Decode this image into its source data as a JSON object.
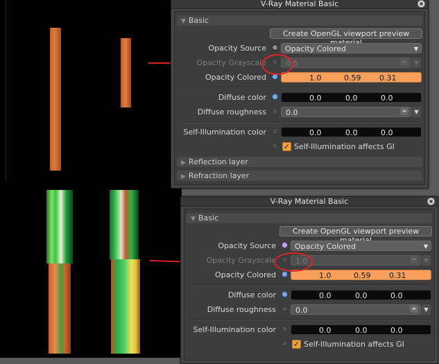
{
  "panels": [
    {
      "title": "V-Ray Material Basic",
      "section": "Basic",
      "create_button": "Create OpenGL viewport preview material",
      "opacity_source_label": "Opacity Source",
      "opacity_source_value": "Opacity Colored",
      "opacity_grayscale_label": "Opacity Grayscale",
      "opacity_grayscale_value": "0.5",
      "opacity_colored_label": "Opacity Colored",
      "opacity_colored": [
        "1.0",
        "0.59",
        "0.31"
      ],
      "diffuse_color_label": "Diffuse color",
      "diffuse_color": [
        "0.0",
        "0.0",
        "0.0"
      ],
      "diffuse_roughness_label": "Diffuse roughness",
      "diffuse_roughness_value": "0.0",
      "self_illum_label": "Self-Illumination color",
      "self_illum": [
        "0.0",
        "0.0",
        "0.0"
      ],
      "self_illum_gi_label": "Self-Illumination affects GI",
      "reflection_layer": "Reflection layer",
      "refraction_layer": "Refraction layer"
    },
    {
      "title": "V-Ray Material Basic",
      "section": "Basic",
      "create_button": "Create OpenGL viewport preview material",
      "opacity_source_label": "Opacity Source",
      "opacity_source_value": "Opacity Colored",
      "opacity_grayscale_label": "Opacity Grayscale",
      "opacity_grayscale_value": "1.0",
      "opacity_colored_label": "Opacity Colored",
      "opacity_colored": [
        "1.0",
        "0.59",
        "0.31"
      ],
      "diffuse_color_label": "Diffuse color",
      "diffuse_color": [
        "0.0",
        "0.0",
        "0.0"
      ],
      "diffuse_roughness_label": "Diffuse roughness",
      "diffuse_roughness_value": "0.0",
      "self_illum_label": "Self-Illumination color",
      "self_illum": [
        "0.0",
        "0.0",
        "0.0"
      ],
      "self_illum_gi_label": "Self-Illumination affects GI"
    }
  ],
  "colors": {
    "opacity_colored_swatch": "#f6a05c",
    "annotation_red": "#d91e1e",
    "checkbox_orange": "#f2a13a"
  },
  "icons": {
    "close": "close-circle-icon",
    "dropdown": "chevron-down-icon",
    "map_dot": "texture-map-dot-icon",
    "spinner": "spinner-arrows-icon",
    "check": "checkmark-icon"
  },
  "checkmark_glyph": "✓"
}
